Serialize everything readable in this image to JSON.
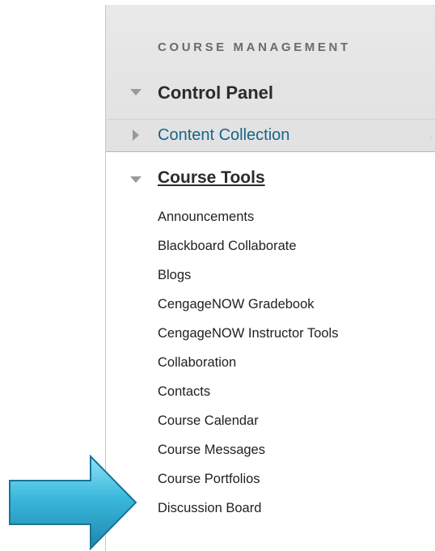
{
  "course_management": {
    "heading": "COURSE MANAGEMENT",
    "control_panel": "Control Panel",
    "content_collection": "Content Collection",
    "course_tools": {
      "label": "Course Tools",
      "items": [
        "Announcements",
        "Blackboard Collaborate",
        "Blogs",
        "CengageNOW Gradebook",
        "CengageNOW Instructor Tools",
        "Collaboration",
        "Contacts",
        "Course Calendar",
        "Course Messages",
        "Course Portfolios",
        "Discussion Board"
      ]
    }
  },
  "icons": {
    "collapse": "triangle-down-icon",
    "expand": "triangle-right-icon",
    "pointer": "arrow-right-icon",
    "chevron": "chevron-right-icon"
  },
  "colors": {
    "link_blue": "#19658a",
    "arrow_fill": "#34b6d8",
    "panel_gray": "#e4e4e4"
  }
}
